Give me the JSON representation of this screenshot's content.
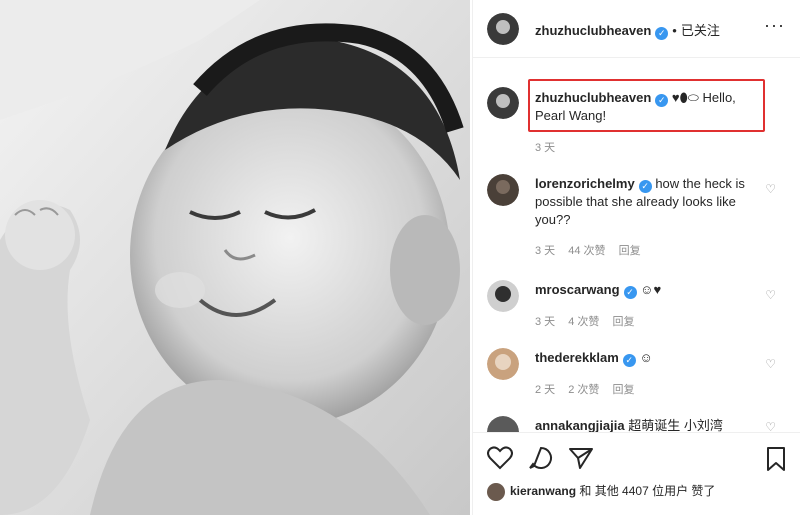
{
  "post": {
    "author": "zhuzhuclubheaven",
    "follow_status": "已关注",
    "separator": "•",
    "more_glyph": "···"
  },
  "caption": {
    "author": "zhuzhuclubheaven",
    "emojis": "♥⬮⬭",
    "text": "Hello, Pearl Wang!",
    "time": "3 天"
  },
  "comments": [
    {
      "user": "lorenzorichelmy",
      "text": "how the heck is possible that she already looks like you??",
      "time": "3 天",
      "likes": "44 次赞",
      "reply": "回复"
    },
    {
      "user": "mroscarwang",
      "text": "☺♥",
      "time": "3 天",
      "likes": "4 次赞",
      "reply": "回复"
    },
    {
      "user": "thederekklam",
      "text": "☺",
      "time": "2 天",
      "likes": "2 次赞",
      "reply": "回复"
    },
    {
      "user": "annakangjiajia",
      "text": "超萌诞生 小刘湾",
      "time": "",
      "likes": "",
      "reply": ""
    }
  ],
  "likes_line": {
    "user": "kieranwang",
    "text": "和 其他 4407 位用户 赞了"
  },
  "icons": [
    "heart-icon",
    "comment-icon",
    "share-icon",
    "bookmark-icon",
    "verified-icon"
  ]
}
